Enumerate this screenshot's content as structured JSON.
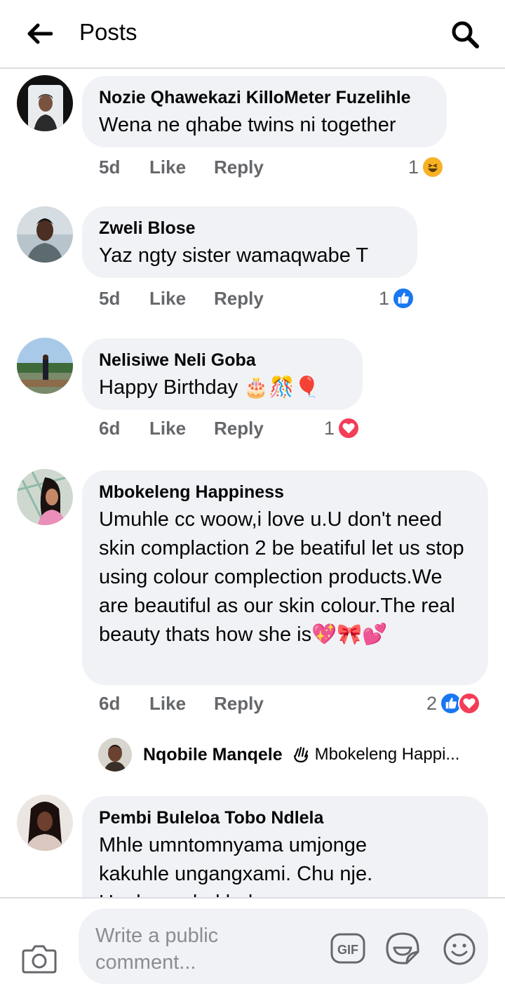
{
  "header": {
    "title": "Posts"
  },
  "comments": [
    {
      "author": "Nozie Qhawekazi KilloMeter Fuzelihle",
      "text": "Wena ne qhabe twins ni together",
      "time": "5d",
      "like": "Like",
      "reply": "Reply",
      "reaction_count": "1",
      "reactions": [
        "haha"
      ]
    },
    {
      "author": "Zweli Blose",
      "text": "Yaz ngty sister wamaqwabe T",
      "time": "5d",
      "like": "Like",
      "reply": "Reply",
      "reaction_count": "1",
      "reactions": [
        "like"
      ]
    },
    {
      "author": "Nelisiwe Neli Goba",
      "text": "Happy Birthday",
      "emoji": "🎂🎊🎈",
      "time": "6d",
      "like": "Like",
      "reply": "Reply",
      "reaction_count": "1",
      "reactions": [
        "love"
      ]
    },
    {
      "author": "Mbokeleng Happiness",
      "text": "Umuhle cc woow,i love u.U don't need skin complaction 2 be beatiful let us stop using colour complection products.We are beautiful as our skin colour.The real beauty thats how she is",
      "emoji": "💖🎀💕",
      "time": "6d",
      "like": "Like",
      "reply": "Reply",
      "reaction_count": "2",
      "reactions": [
        "like",
        "love"
      ]
    },
    {
      "author": "Pembi Buleloa Tobo Ndlela",
      "text": "Mhle umntomnyama umjonge kakuhle ungangxami. Chu nje. Ungbangabekhala"
    }
  ],
  "reply_preview": {
    "author": "Nqobile Manqele",
    "reply_to": "Mbokeleng Happi..."
  },
  "composer": {
    "placeholder": "Write a public comment..."
  },
  "colors": {
    "like": "#1877f2",
    "love": "#f33e58",
    "haha": "#f7b125",
    "bubble": "#f0f2f5",
    "meta": "#65676b"
  },
  "icons": [
    "back-arrow-icon",
    "search-icon",
    "camera-icon",
    "gif-icon",
    "sticker-icon",
    "emoji-icon",
    "reply-arrow-icon"
  ]
}
